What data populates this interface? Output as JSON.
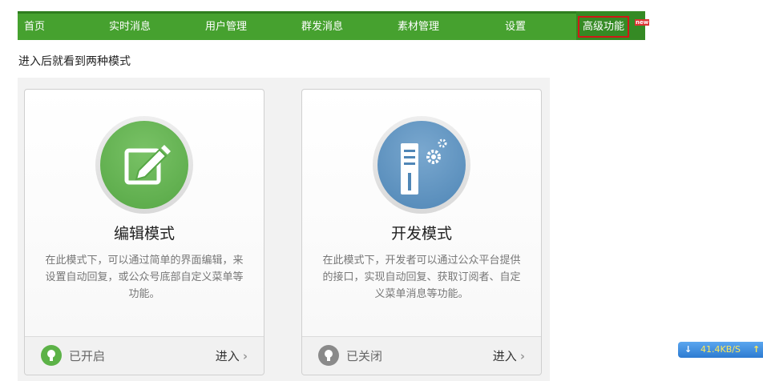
{
  "nav": {
    "items": [
      {
        "label": "首页"
      },
      {
        "label": "实时消息"
      },
      {
        "label": "用户管理"
      },
      {
        "label": "群发消息"
      },
      {
        "label": "素材管理"
      },
      {
        "label": "设置"
      },
      {
        "label": "高级功能"
      }
    ],
    "new_badge": "new",
    "active_index": 6
  },
  "intro_text": "进入后就看到两种模式",
  "cards": [
    {
      "title": "编辑模式",
      "desc": "在此模式下，可以通过简单的界面编辑，来设置自动回复，或公众号底部自定义菜单等功能。",
      "status": "已开启",
      "enter": "进入",
      "icon": "edit-icon",
      "accent": "#56a745"
    },
    {
      "title": "开发模式",
      "desc": "在此模式下，开发者可以通过公众平台提供的接口，实现自动回复、获取订阅者、自定义菜单消息等功能。",
      "status": "已关闭",
      "enter": "进入",
      "icon": "server-gear-icon",
      "accent": "#4f86b6"
    }
  ],
  "speed_widget": {
    "value": "41.4KB/S"
  }
}
